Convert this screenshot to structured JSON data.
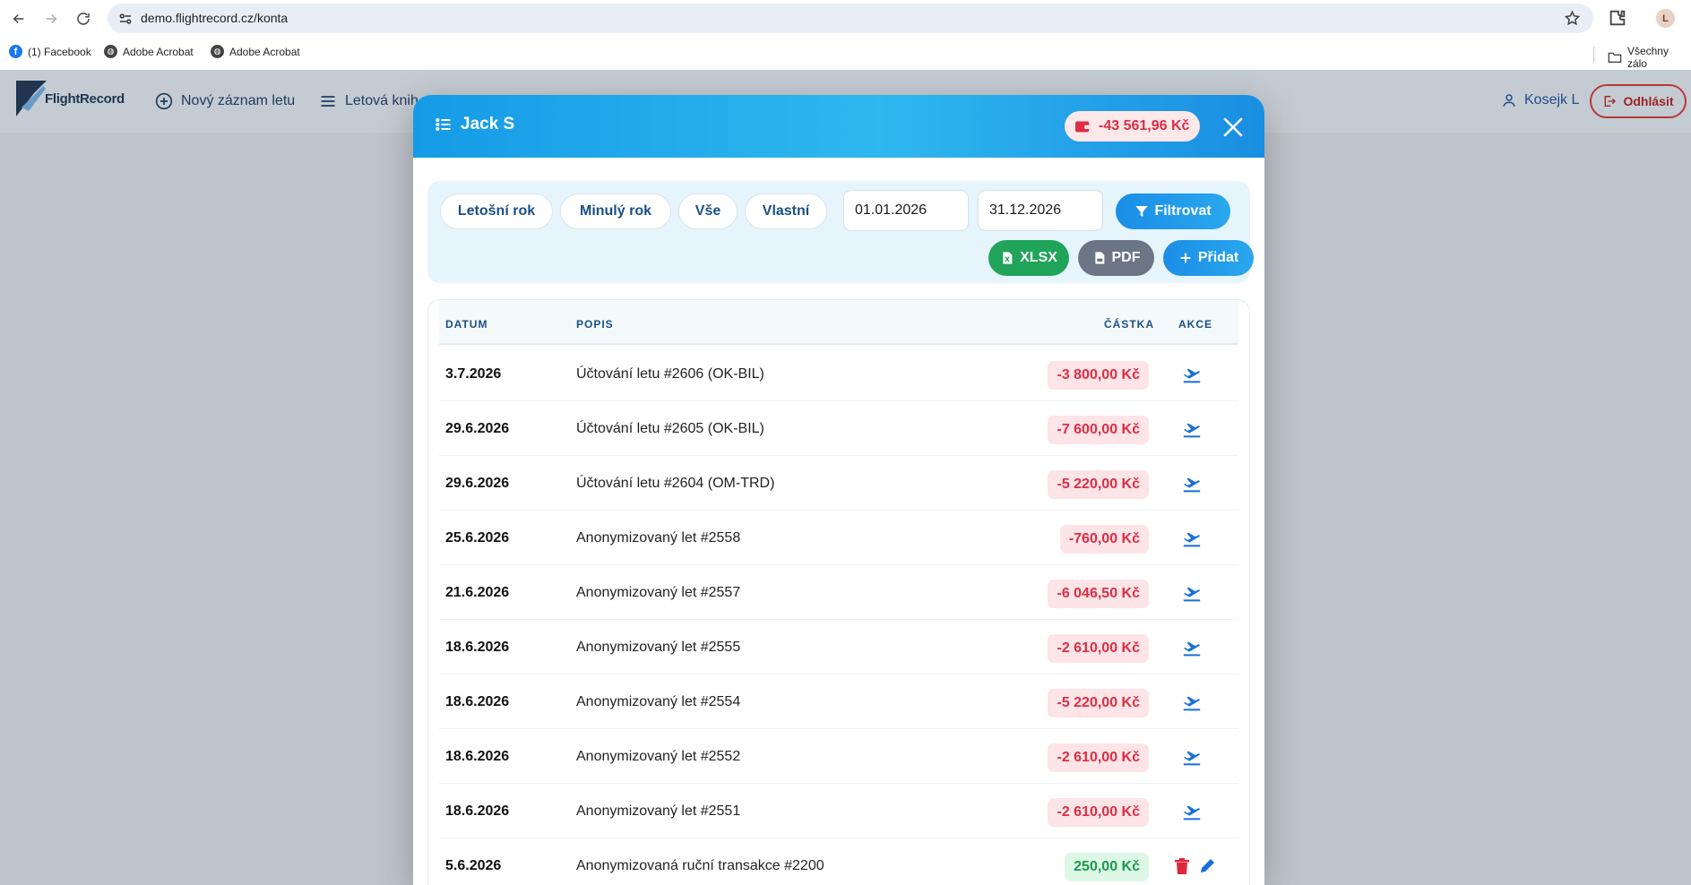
{
  "browser": {
    "url": "demo.flightrecord.cz/konta",
    "profile_initial": "L",
    "bookmarks": [
      {
        "label": "(1) Facebook"
      },
      {
        "label": "Adobe Acrobat"
      },
      {
        "label": "Adobe Acrobat"
      }
    ],
    "all_bookmarks_label": "Všechny zálo"
  },
  "app": {
    "logo_text": "FlightRecord",
    "nav": {
      "new_record": "Nový záznam letu",
      "logbook": "Letová knih"
    },
    "user_name": "Kosejk L",
    "logout_label": "Odhlásit"
  },
  "modal": {
    "title": "Jack S",
    "balance": "-43 561,96 Kč",
    "filters": {
      "this_year": "Letošní rok",
      "last_year": "Minulý rok",
      "all": "Vše",
      "custom": "Vlastní",
      "date_from": "01.01.2026",
      "date_to": "31.12.2026",
      "filter_button": "Filtrovat",
      "xlsx_button": "XLSX",
      "pdf_button": "PDF",
      "add_button": "Přidat"
    },
    "table": {
      "headers": {
        "date": "DATUM",
        "description": "POPIS",
        "amount": "ČÁSTKA",
        "actions": "AKCE"
      },
      "rows": [
        {
          "date": "3.7.2026",
          "description": "Účtování letu #2606 (OK-BIL)",
          "amount": "-3 800,00 Kč",
          "type": "flight"
        },
        {
          "date": "29.6.2026",
          "description": "Účtování letu #2605 (OK-BIL)",
          "amount": "-7 600,00 Kč",
          "type": "flight"
        },
        {
          "date": "29.6.2026",
          "description": "Účtování letu #2604 (OM-TRD)",
          "amount": "-5 220,00 Kč",
          "type": "flight"
        },
        {
          "date": "25.6.2026",
          "description": "Anonymizovaný let #2558",
          "amount": "-760,00 Kč",
          "type": "flight"
        },
        {
          "date": "21.6.2026",
          "description": "Anonymizovaný let #2557",
          "amount": "-6 046,50 Kč",
          "type": "flight"
        },
        {
          "date": "18.6.2026",
          "description": "Anonymizovaný let #2555",
          "amount": "-2 610,00 Kč",
          "type": "flight"
        },
        {
          "date": "18.6.2026",
          "description": "Anonymizovaný let #2554",
          "amount": "-5 220,00 Kč",
          "type": "flight"
        },
        {
          "date": "18.6.2026",
          "description": "Anonymizovaný let #2552",
          "amount": "-2 610,00 Kč",
          "type": "flight"
        },
        {
          "date": "18.6.2026",
          "description": "Anonymizovaný let #2551",
          "amount": "-2 610,00 Kč",
          "type": "flight"
        },
        {
          "date": "5.6.2026",
          "description": "Anonymizovaná ruční transakce #2200",
          "amount": "250,00 Kč",
          "type": "manual"
        }
      ]
    }
  },
  "colors": {
    "header_gradient_start": "#159be6",
    "negative": "#dc2e45",
    "positive": "#1c9a4e",
    "primary": "#1a8ee6"
  }
}
